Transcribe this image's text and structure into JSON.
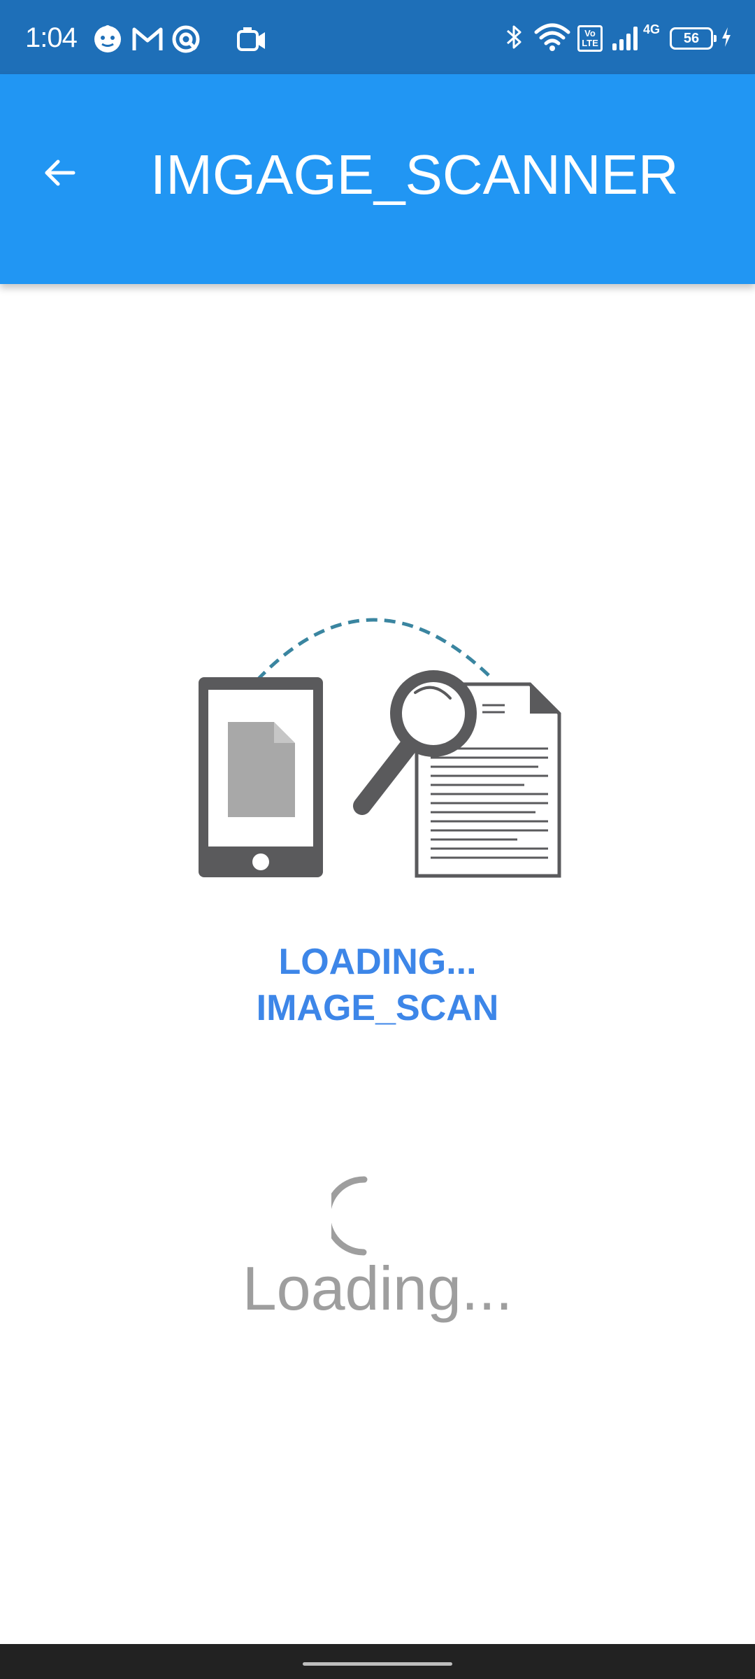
{
  "status_bar": {
    "time": "1:04",
    "network_type": "4G",
    "volte_label": "Vo LTE",
    "battery_level": "56",
    "background_color": "#1e6fb8",
    "left_icons": [
      "baby-face-icon",
      "gmail-icon",
      "target-icon",
      "video-camera-icon"
    ],
    "right_icons": [
      "bluetooth-icon",
      "wifi-icon",
      "volte-icon",
      "signal-icon",
      "battery-icon",
      "charging-icon"
    ]
  },
  "app_bar": {
    "title": "IMGAGE_SCANNER",
    "back_icon": "arrow-back-icon",
    "background_color": "#2196f3"
  },
  "main": {
    "illustration": "phone-document-magnifier-illustration",
    "heading_line1": "LOADING...",
    "heading_line2": "IMAGE_SCAN",
    "heading_color": "#3d86e8",
    "spinner_icon": "loading-spinner-icon",
    "loading_text": "Loading...",
    "loading_text_color": "#9e9e9e"
  },
  "navigation_bar": {
    "handle": "gesture-handle"
  }
}
